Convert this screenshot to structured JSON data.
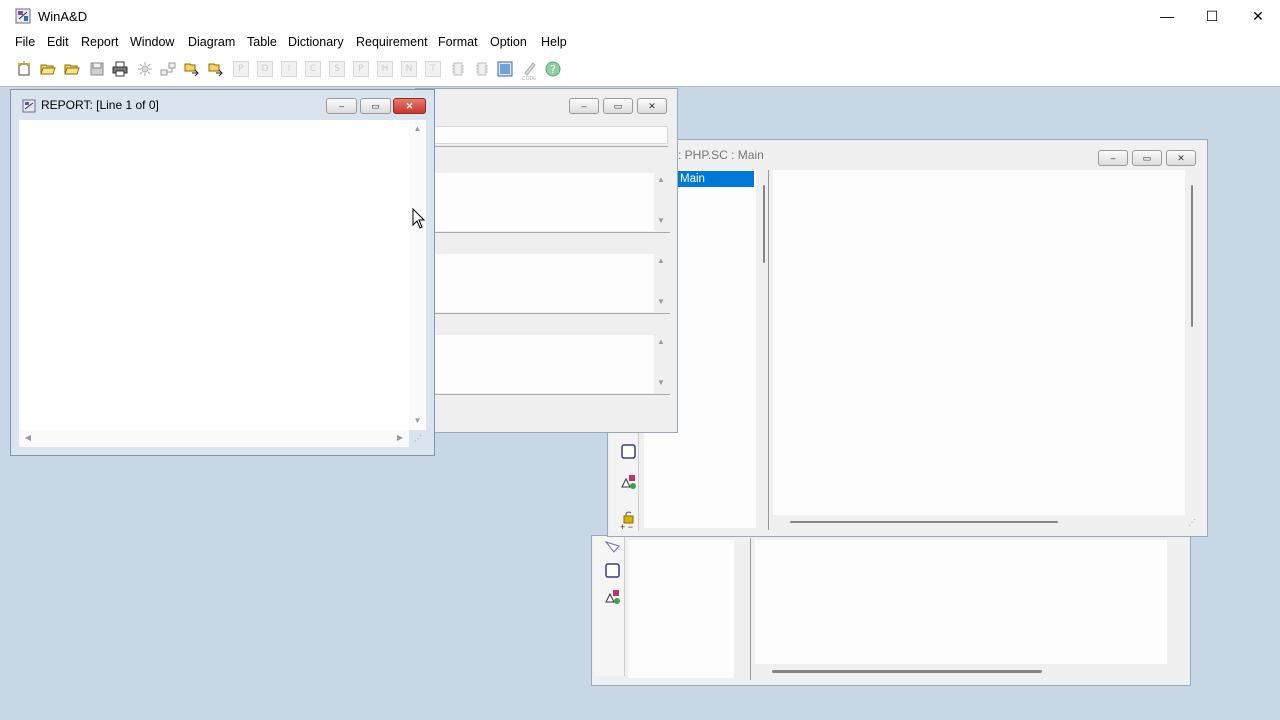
{
  "app": {
    "title": "WinA&D",
    "window_controls": {
      "minimize": "—",
      "maximize": "☐",
      "close": "✕"
    }
  },
  "menu": [
    "File",
    "Edit",
    "Report",
    "Window",
    "Diagram",
    "Table",
    "Dictionary",
    "Requirement",
    "Format",
    "Option",
    "Help"
  ],
  "toolbar": {
    "disabled_letters": [
      "P",
      "D",
      "I",
      "C",
      "S",
      "P",
      "H",
      "N",
      "T"
    ],
    "code_label": "CODE",
    "help_glyph": "?"
  },
  "report_window": {
    "title": "REPORT:  [Line 1 of 0]",
    "controls": {
      "minimize": "–",
      "restore": "▭",
      "close": "✕"
    }
  },
  "middle_window": {
    "controls": {
      "minimize": "–",
      "restore": "▭",
      "close": "✕"
    }
  },
  "diagram_window": {
    "title": ": PHP.SC : Main",
    "selected_item": "Main",
    "controls": {
      "minimize": "–",
      "restore": "▭",
      "close": "✕"
    }
  },
  "colors": {
    "desktop": "#c8d7e6",
    "selection": "#0078d7",
    "close_red": "#d9432f"
  }
}
